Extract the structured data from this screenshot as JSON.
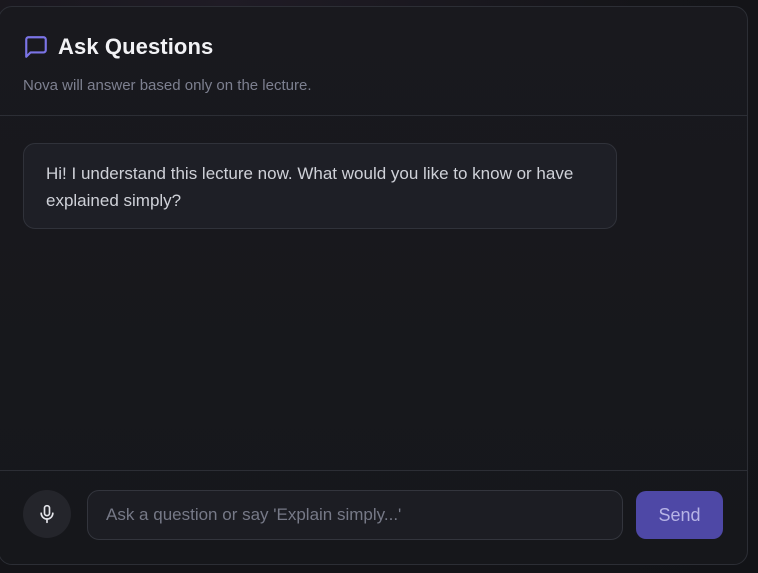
{
  "header": {
    "title": "Ask Questions",
    "subtitle": "Nova will answer based only on the lecture.",
    "icon": "chat-bubble-icon",
    "icon_color": "#7b74e6"
  },
  "messages": [
    {
      "role": "assistant",
      "text": "Hi! I understand this lecture now. What would you like to know or have explained simply?"
    }
  ],
  "composer": {
    "mic_icon": "microphone-icon",
    "input_value": "",
    "input_placeholder": "Ask a question or say 'Explain simply...'",
    "send_label": "Send",
    "send_color": "#4e48a6"
  }
}
